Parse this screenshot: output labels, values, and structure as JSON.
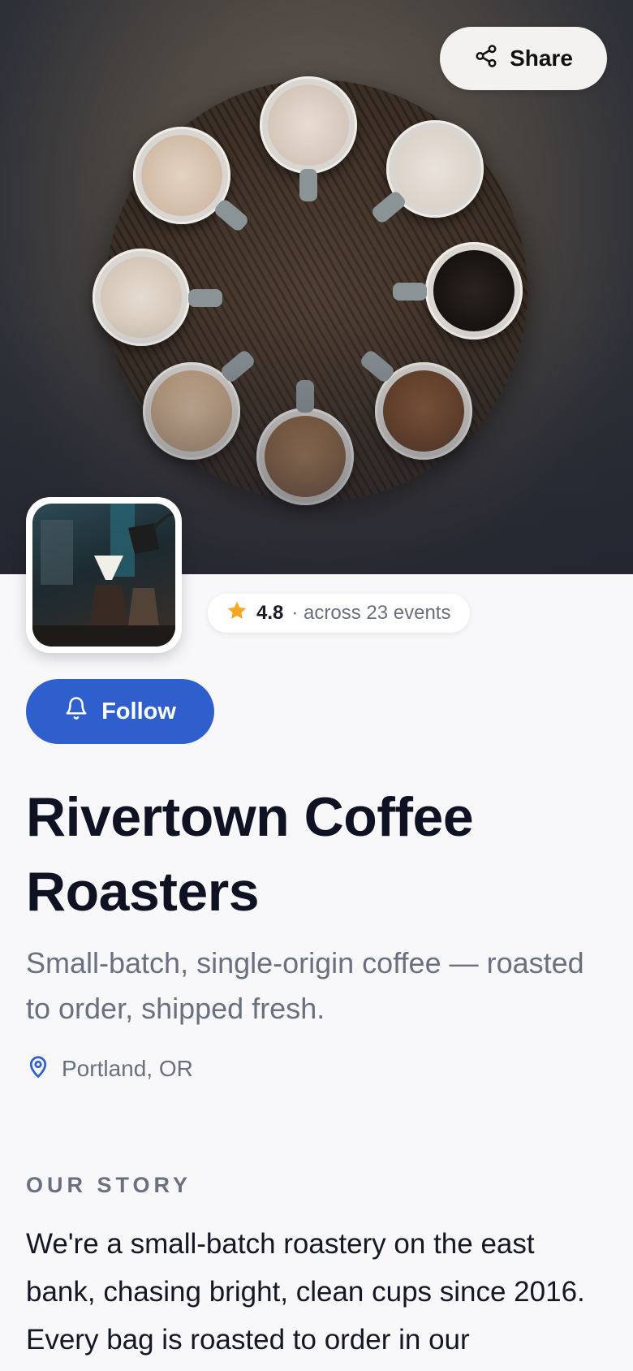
{
  "header": {
    "share_label": "Share"
  },
  "profile": {
    "rating": "4.8",
    "rating_detail": "· across 23 events",
    "follow_label": "Follow",
    "name": "Rivertown Coffee Roasters",
    "tagline": "Small-batch, single-origin coffee — roasted to order, shipped fresh.",
    "location": "Portland, OR"
  },
  "story": {
    "label": "OUR STORY",
    "text": "We're a small-batch roastery on the east bank, chasing bright, clean cups since 2016. Every bag is roasted to order in our"
  },
  "icons": {
    "share": "share-icon",
    "star": "star-icon",
    "bell": "bell-icon",
    "location": "map-pin-icon"
  },
  "colors": {
    "accent": "#2f5fcc",
    "star": "#f5a623",
    "background": "#f8f8fb"
  }
}
